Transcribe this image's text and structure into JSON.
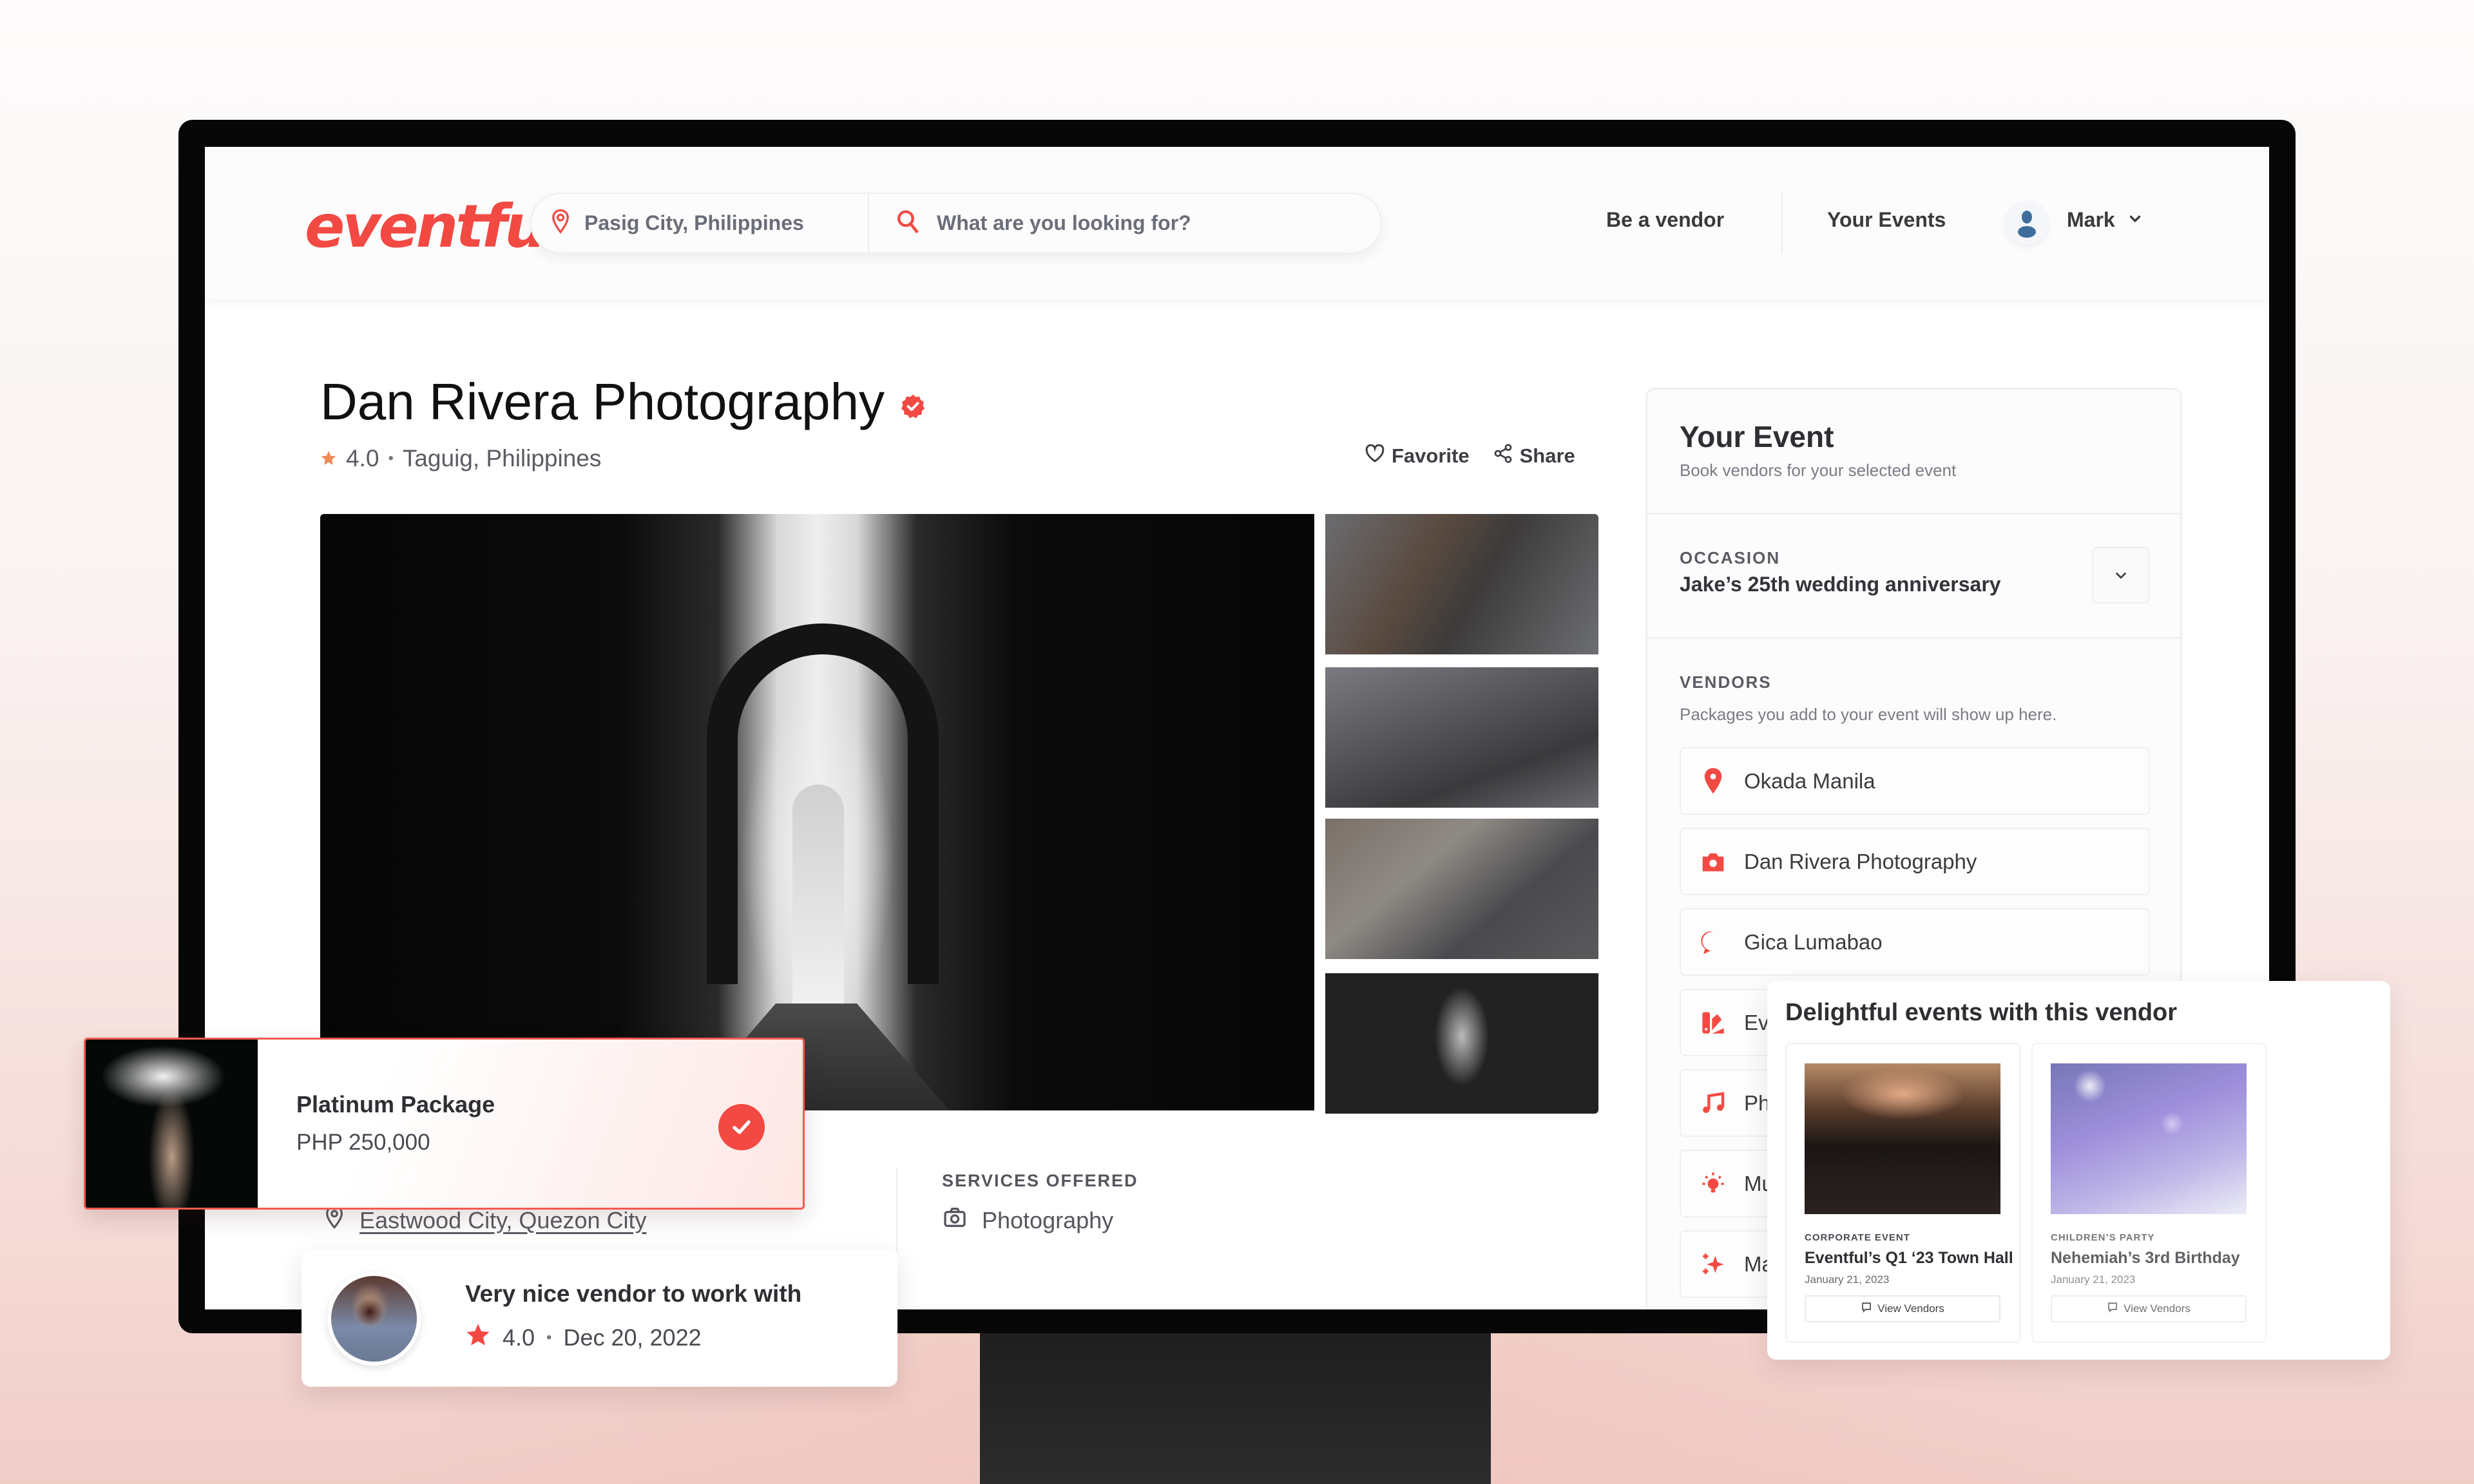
{
  "header": {
    "logo": "eventful",
    "location": "Pasig City, Philippines",
    "search_placeholder": "What are you looking for?",
    "nav": {
      "be_vendor": "Be a vendor",
      "your_events": "Your Events",
      "user_name": "Mark"
    }
  },
  "vendor": {
    "name": "Dan Rivera Photography",
    "verified": true,
    "rating": "4.0",
    "location": "Taguig, Philippines",
    "actions": {
      "favorite": "Favorite",
      "share": "Share"
    },
    "address": "Eastwood City, Quezon City",
    "services_label": "SERVICES OFFERED",
    "services": [
      "Photography"
    ]
  },
  "your_event": {
    "title": "Your Event",
    "subtitle": "Book vendors for your selected event",
    "occasion_label": "OCCASION",
    "occasion_value": "Jake’s 25th wedding anniversary",
    "vendors_label": "VENDORS",
    "vendors_desc": "Packages you add to your event will show up here.",
    "vendors": [
      {
        "name": "Okada Manila",
        "icon": "location-pin-icon"
      },
      {
        "name": "Dan Rivera Photography",
        "icon": "camera-icon"
      },
      {
        "name": "Gica Lumabao",
        "icon": "chat-bubble-icon"
      },
      {
        "name": "Ev",
        "icon": "swatch-icon"
      },
      {
        "name": "Ph",
        "icon": "music-note-icon"
      },
      {
        "name": "Mu",
        "icon": "lightbulb-icon"
      },
      {
        "name": "Ma",
        "icon": "sparkle-icon"
      }
    ]
  },
  "package": {
    "name": "Platinum Package",
    "price": "PHP 250,000",
    "selected": true
  },
  "review": {
    "text": "Very nice vendor to work with",
    "rating": "4.0",
    "date": "Dec 20, 2022"
  },
  "events_with_vendor": {
    "title": "Delightful events with this vendor",
    "items": [
      {
        "category": "CORPORATE EVENT",
        "name": "Eventful’s Q1 ‘23 Town Hall",
        "date": "January 21, 2023",
        "button": "View Vendors"
      },
      {
        "category": "CHILDREN’S PARTY",
        "name": "Nehemiah’s 3rd Birthday",
        "date": "January 21, 2023",
        "button": "View Vendors"
      }
    ]
  },
  "colors": {
    "brand": "#f24a43",
    "text_dark": "#2e2e33",
    "text_muted": "#7a7b84",
    "border": "#f0f0f2",
    "background_pink": "#f1cdc8"
  }
}
